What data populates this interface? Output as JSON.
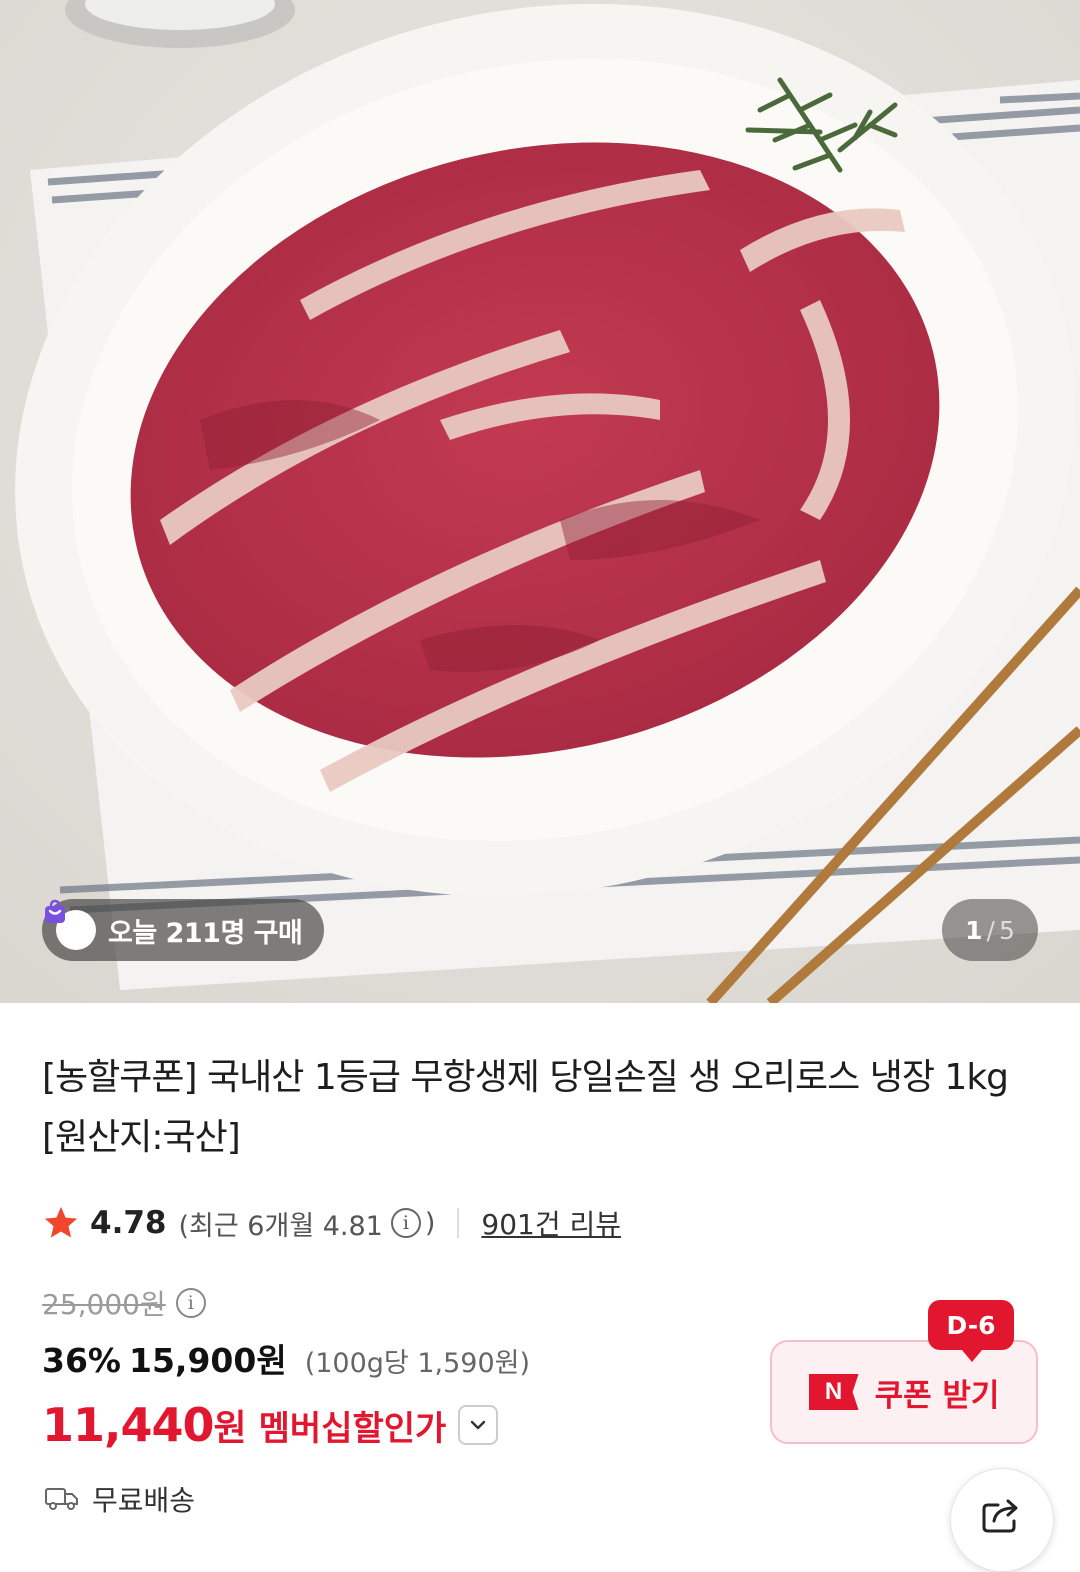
{
  "hero": {
    "buyers_badge": "오늘 211명 구매",
    "pager": {
      "current": "1",
      "separator": "/",
      "total": "5"
    }
  },
  "product": {
    "title": "[농할쿠폰] 국내산 1등급 무항생제 당일손질 생 오리로스 냉장 1kg [원산지:국산]"
  },
  "rating": {
    "score": "4.78",
    "recent_prefix": "(최근 6개월 4.81",
    "info_glyph": "i",
    "recent_suffix": ")",
    "review_count": "901건 리뷰"
  },
  "price": {
    "original": "25,000원",
    "discount_rate": "36%",
    "sale": "15,900원",
    "unit_price": "(100g당 1,590원)",
    "member_price_number": "11,440",
    "member_price_unit": "원",
    "member_label": "멤버십할인가"
  },
  "shipping": {
    "label": "무료배송"
  },
  "coupon": {
    "dday": "D-6",
    "logo_letter": "N",
    "label": "쿠폰 받기"
  },
  "colors": {
    "accent_red": "#e2172f",
    "coupon_bg": "#fdf0f2",
    "badge_purple": "#7b4fe0"
  }
}
